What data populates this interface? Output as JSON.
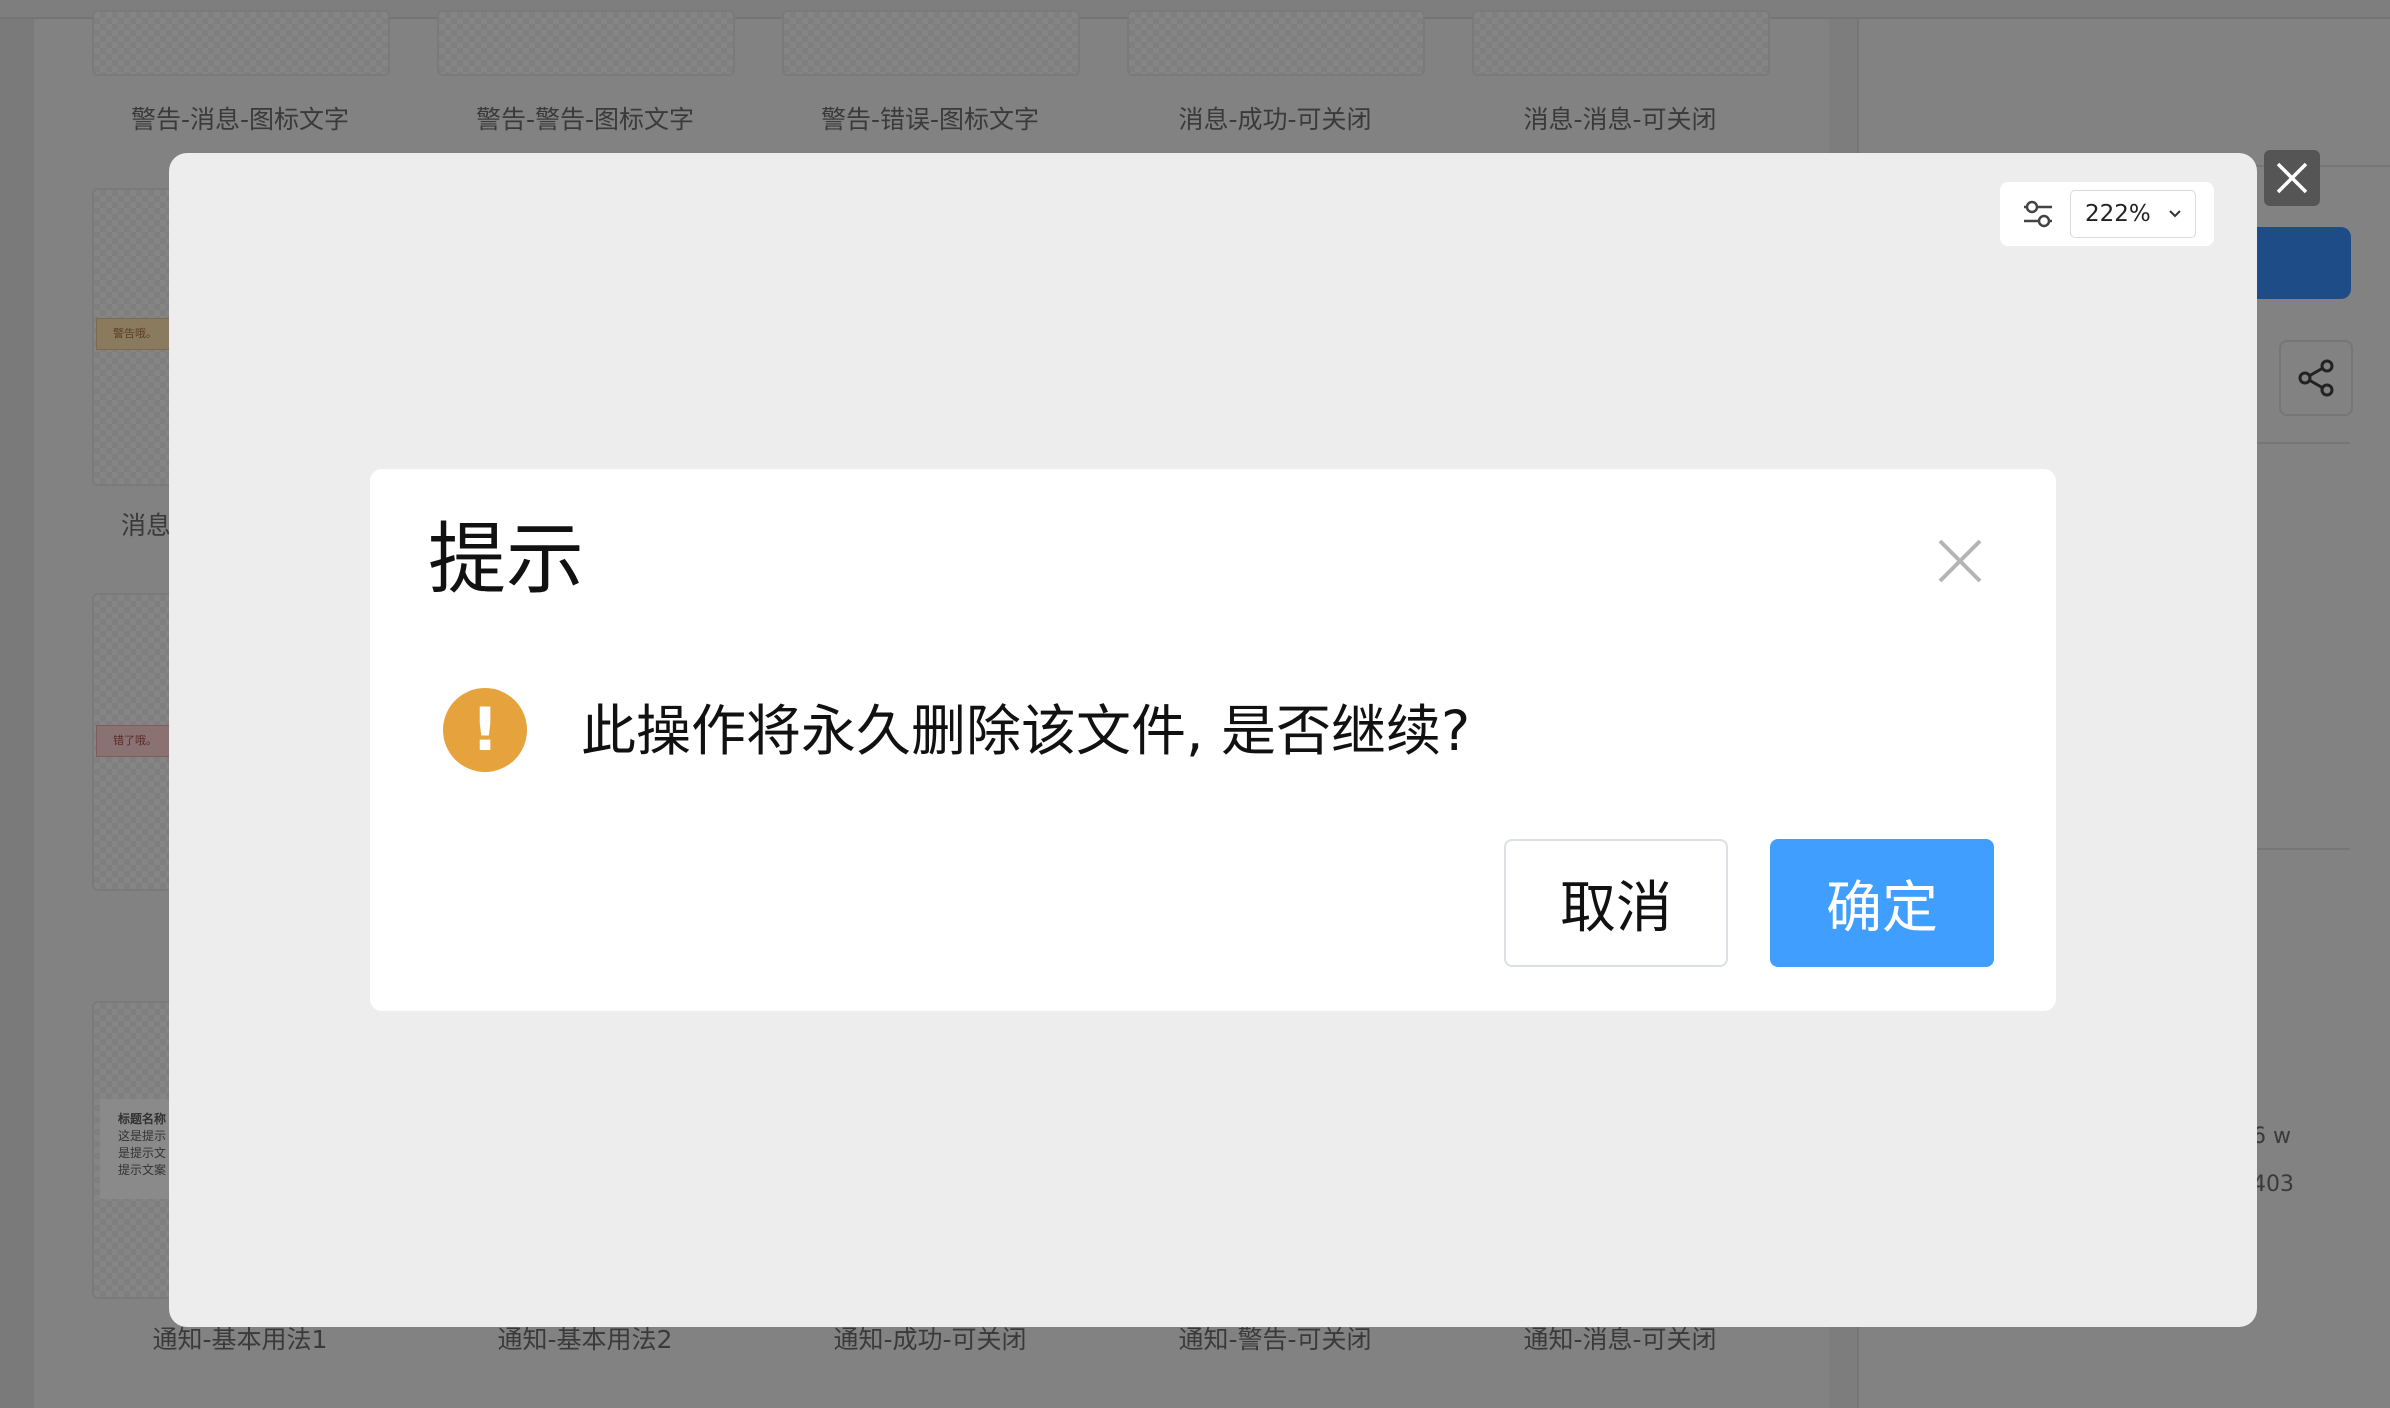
{
  "background": {
    "thumbnail_labels_top": [
      "警告-消息-图标文字",
      "警告-警告-图标文字",
      "警告-错误-图标文字",
      "消息-成功-可关闭",
      "消息-消息-可关闭"
    ],
    "thumbnail_labels_bottom": [
      "通知-基本用法1",
      "通知-基本用法2",
      "通知-成功-可关闭",
      "通知-警告-可关闭",
      "通知-消息-可关闭"
    ],
    "partial_label_row2": "消息",
    "warn_strip_text": "警告哦。",
    "error_strip_text": "错了哦。",
    "notice_card_title": "标题名称",
    "notice_card_lines": [
      "这是提示",
      "是提示文",
      "提示文案"
    ],
    "right_panel_texts": [
      "6 w",
      "403"
    ]
  },
  "preview": {
    "zoom_value": "222%",
    "settings_icon": "sliders-icon",
    "close_icon": "close-icon"
  },
  "dialog": {
    "title": "提示",
    "message": "此操作将永久删除该文件, 是否继续?",
    "icon": "warning-icon",
    "icon_color": "#e6a23c",
    "cancel_label": "取消",
    "confirm_label": "确定",
    "confirm_color": "#409eff"
  }
}
